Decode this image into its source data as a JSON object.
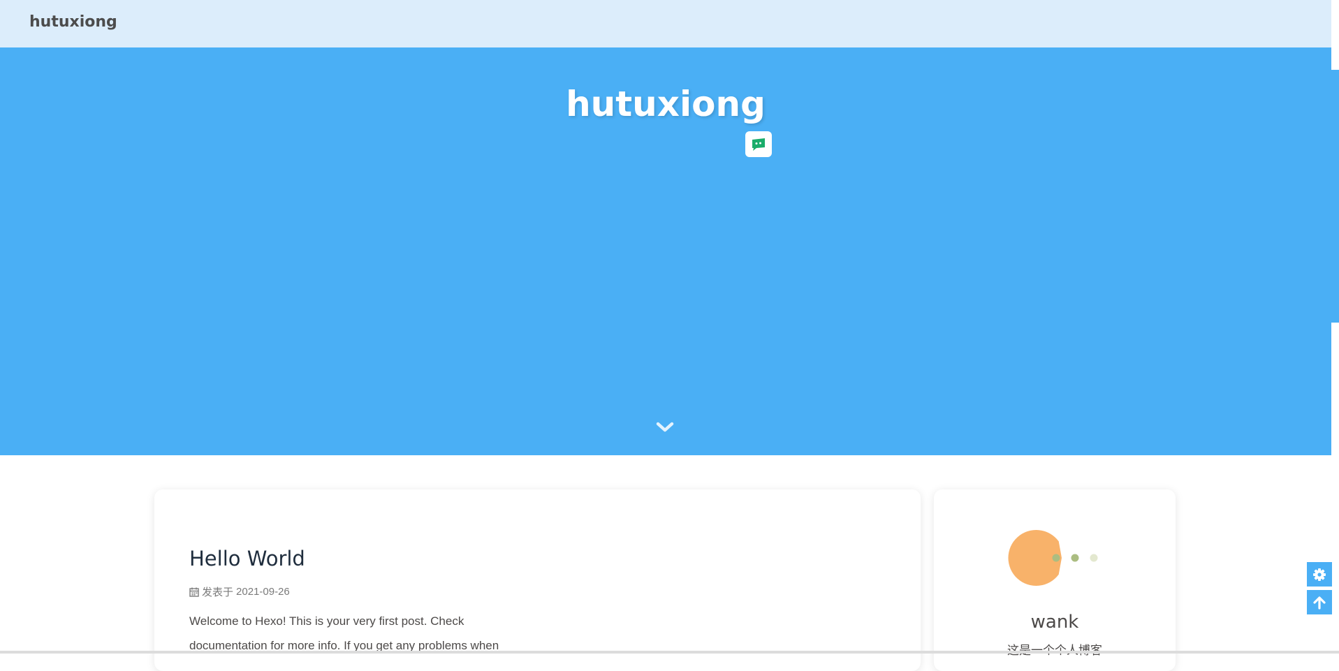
{
  "header": {
    "site_name": "hutuxiong"
  },
  "hero": {
    "title": "hutuxiong"
  },
  "post": {
    "title": "Hello World",
    "meta_label": "发表于",
    "date": "2021-09-26",
    "excerpt": "Welcome to Hexo! This is your very first post. Check documentation for more info. If you get any problems when"
  },
  "author": {
    "name": "wank",
    "description": "这是一个个人博客"
  },
  "icons": {
    "chat": "wechat-chat-icon",
    "scroll_down": "chevron-down-icon",
    "calendar": "calendar-icon",
    "settings": "gear-icon",
    "back_to_top": "arrow-up-icon",
    "avatar": "pacman-avatar"
  },
  "colors": {
    "header_bg": "#dcedfb",
    "hero_bg": "#4aaff5",
    "accent": "#4aaff5",
    "avatar_body": "#f8b26a",
    "avatar_dots": "#abbd81"
  }
}
